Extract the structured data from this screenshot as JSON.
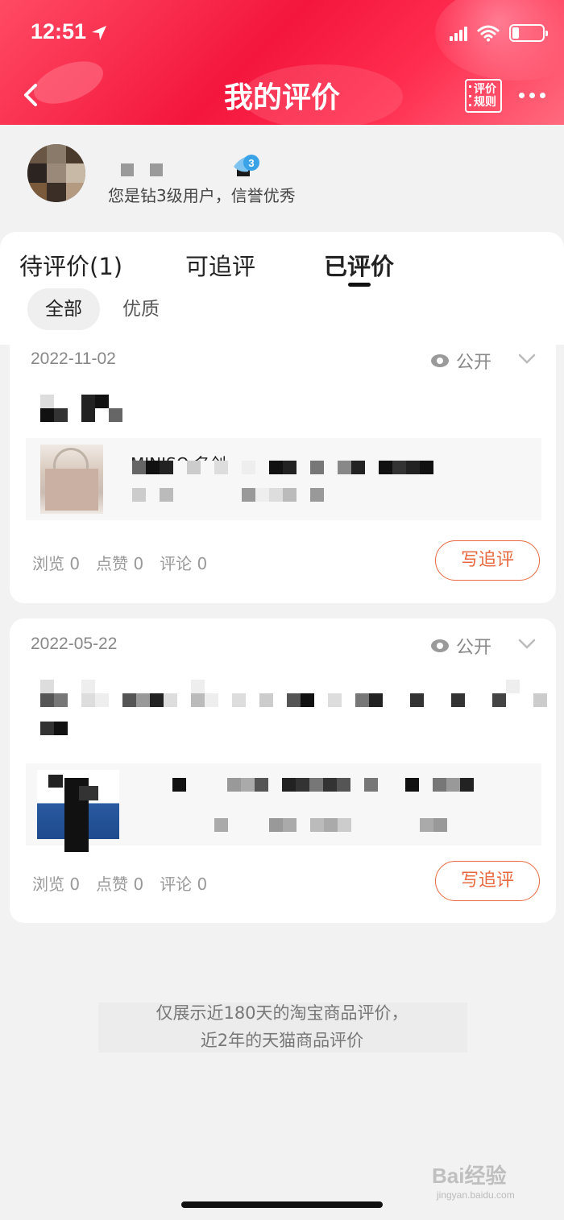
{
  "status_bar": {
    "time": "12:51"
  },
  "header": {
    "title": "我的评价",
    "rules_label_line1": "评价",
    "rules_label_line2": "规则"
  },
  "user": {
    "level_badge": "3",
    "description": "您是钻3级用户，信誉优秀"
  },
  "tabs": [
    {
      "label": "待评价(1)",
      "active": false
    },
    {
      "label": "可追评",
      "active": false
    },
    {
      "label": "已评价",
      "active": true
    }
  ],
  "filters": [
    {
      "label": "全部",
      "active": true
    },
    {
      "label": "优质",
      "active": false
    }
  ],
  "reviews": [
    {
      "date": "2022-11-02",
      "visibility": "公开",
      "product_title": "MINISO 名创",
      "stats": {
        "views": "浏览 0",
        "likes": "点赞 0",
        "comments": "评论 0"
      },
      "action": "写追评"
    },
    {
      "date": "2022-05-22",
      "visibility": "公开",
      "stats": {
        "views": "浏览 0",
        "likes": "点赞 0",
        "comments": "评论 0"
      },
      "action": "写追评"
    }
  ],
  "notice": {
    "line1": "仅展示近180天的淘宝商品评价，",
    "line2": "近2年的天猫商品评价"
  },
  "watermark": {
    "brand": "Bai经验",
    "url": "jingyan.baidu.com"
  },
  "colors": {
    "header_red": "#f4163d",
    "accent_orange": "#e8693f"
  }
}
